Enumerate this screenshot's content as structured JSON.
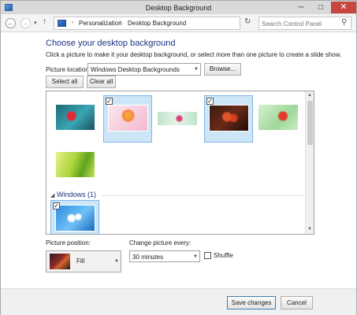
{
  "window": {
    "title": "Desktop Background",
    "minimize_icon": "minimize-icon",
    "maximize_icon": "maximize-icon",
    "close_icon": "close-icon"
  },
  "toolbar": {
    "back_glyph": "←",
    "forward_glyph": "→",
    "recent_glyph": "▾",
    "up_glyph": "↑",
    "address": [
      "Personalization",
      "Desktop Background"
    ],
    "refresh_glyph": "↻",
    "search_placeholder": "Search Control Panel",
    "search_glyph": "⚲"
  },
  "main": {
    "title": "Choose your desktop background",
    "instructions": "Click a picture to make it your desktop background, or select more than one picture to create a slide show.",
    "picture_location_label": "Picture location:",
    "picture_location_value": "Windows Desktop Backgrounds",
    "browse_label": "Browse...",
    "select_all_label": "Select all",
    "clear_all_label": "Clear all"
  },
  "gallery": {
    "group_label": "Windows (1)",
    "thumbnails": [
      {
        "name": "thumbnail-red-flower-teal",
        "selected": false
      },
      {
        "name": "thumbnail-orange-flower-pink",
        "selected": true
      },
      {
        "name": "thumbnail-pink-flower-strip",
        "selected": false
      },
      {
        "name": "thumbnail-red-tulips-dark",
        "selected": true
      },
      {
        "name": "thumbnail-red-flower-green",
        "selected": false
      },
      {
        "name": "thumbnail-green-leaves",
        "selected": false
      },
      {
        "name": "thumbnail-windows-daisies",
        "selected": true
      }
    ]
  },
  "options": {
    "picture_position_label": "Picture position:",
    "picture_position_value": "Fill",
    "change_interval_label": "Change picture every:",
    "change_interval_value": "30 minutes",
    "shuffle_label": "Shuffle",
    "shuffle_checked": false
  },
  "footer": {
    "save_label": "Save changes",
    "cancel_label": "Cancel"
  },
  "colors": {
    "accent": "#1e3287",
    "selection_fill": "#cde6f7",
    "selection_border": "#7eb4ea",
    "close_button": "#c7463f"
  }
}
